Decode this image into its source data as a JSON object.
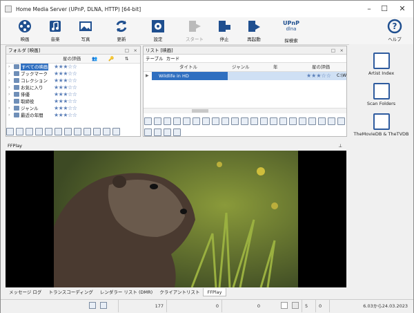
{
  "window": {
    "title": "Home Media Server (UPnP, DLNA, HTTP) [64-bit]"
  },
  "toolbar": [
    {
      "key": "movie",
      "label": "映画"
    },
    {
      "key": "music",
      "label": "音楽"
    },
    {
      "key": "photo",
      "label": "写真"
    },
    {
      "key": "update",
      "label": "更新"
    },
    {
      "key": "settings",
      "label": "設定"
    },
    {
      "key": "start",
      "label": "スタート"
    },
    {
      "key": "stop",
      "label": "停止"
    },
    {
      "key": "restart",
      "label": "再起動"
    },
    {
      "key": "search",
      "label": "探検索"
    },
    {
      "key": "help",
      "label": "ヘルプ"
    }
  ],
  "upnp": {
    "line1": "UPnP",
    "line2": "dlna"
  },
  "folders": {
    "title": "フォルダ [映画]",
    "rating_header": "星の評価",
    "items": [
      "すべての映画",
      "ブックマーク",
      "コレクション",
      "お気に入り",
      "俳優",
      "取締役",
      "ジャンル",
      "最近の年間"
    ]
  },
  "list": {
    "title": "リスト [映画]",
    "tabs": [
      "テーブル",
      "カード"
    ],
    "columns": [
      "タイトル",
      "ジャンル",
      "年",
      "星の評価"
    ],
    "row": {
      "title": "Wildlife in HD",
      "path": "C:\\W"
    }
  },
  "side": [
    "Artist Index",
    "Scan Folders",
    "TheMovieDB & TheTVDB"
  ],
  "ffplay": {
    "title": "FFPlay"
  },
  "bottom_tabs": [
    "メッセージ ログ",
    "トランスコーディング",
    "レンダラー リスト (DMR)",
    "クライアントリスト",
    "FFPlay"
  ],
  "status": {
    "c1": "177",
    "c2": "0",
    "c3": "0",
    "c4": "5",
    "c5": "0",
    "c6": "6.03から24.03.2023"
  },
  "stars": "★★★☆☆"
}
